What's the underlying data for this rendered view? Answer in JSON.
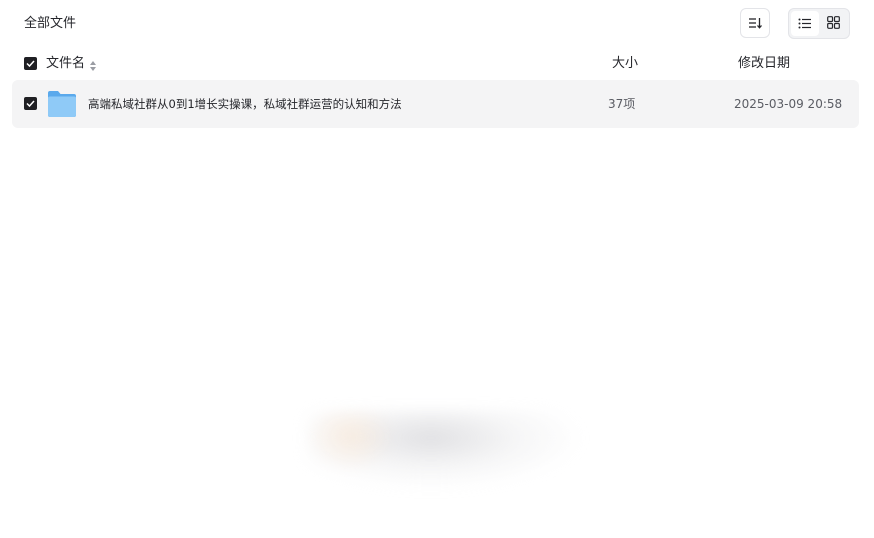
{
  "breadcrumb": {
    "current": "全部文件"
  },
  "toolbar": {
    "sort_icon": "sort-descending-icon",
    "view_list_icon": "list-view-icon",
    "view_grid_icon": "grid-view-icon",
    "active_view": "list"
  },
  "table": {
    "header": {
      "name": "文件名",
      "size": "大小",
      "modified": "修改日期",
      "select_all_checked": true
    },
    "rows": [
      {
        "checked": true,
        "icon": "folder-icon",
        "name": "高端私域社群从0到1增长实操课，私域社群运营的认知和方法",
        "size": "37项",
        "modified": "2025-03-09 20:58"
      }
    ]
  },
  "colors": {
    "row_background": "#f4f4f5",
    "checkbox": "#1f1f23",
    "folder": "#7cc0f4",
    "text_primary": "#25262b",
    "text_secondary": "#5a5c63"
  }
}
